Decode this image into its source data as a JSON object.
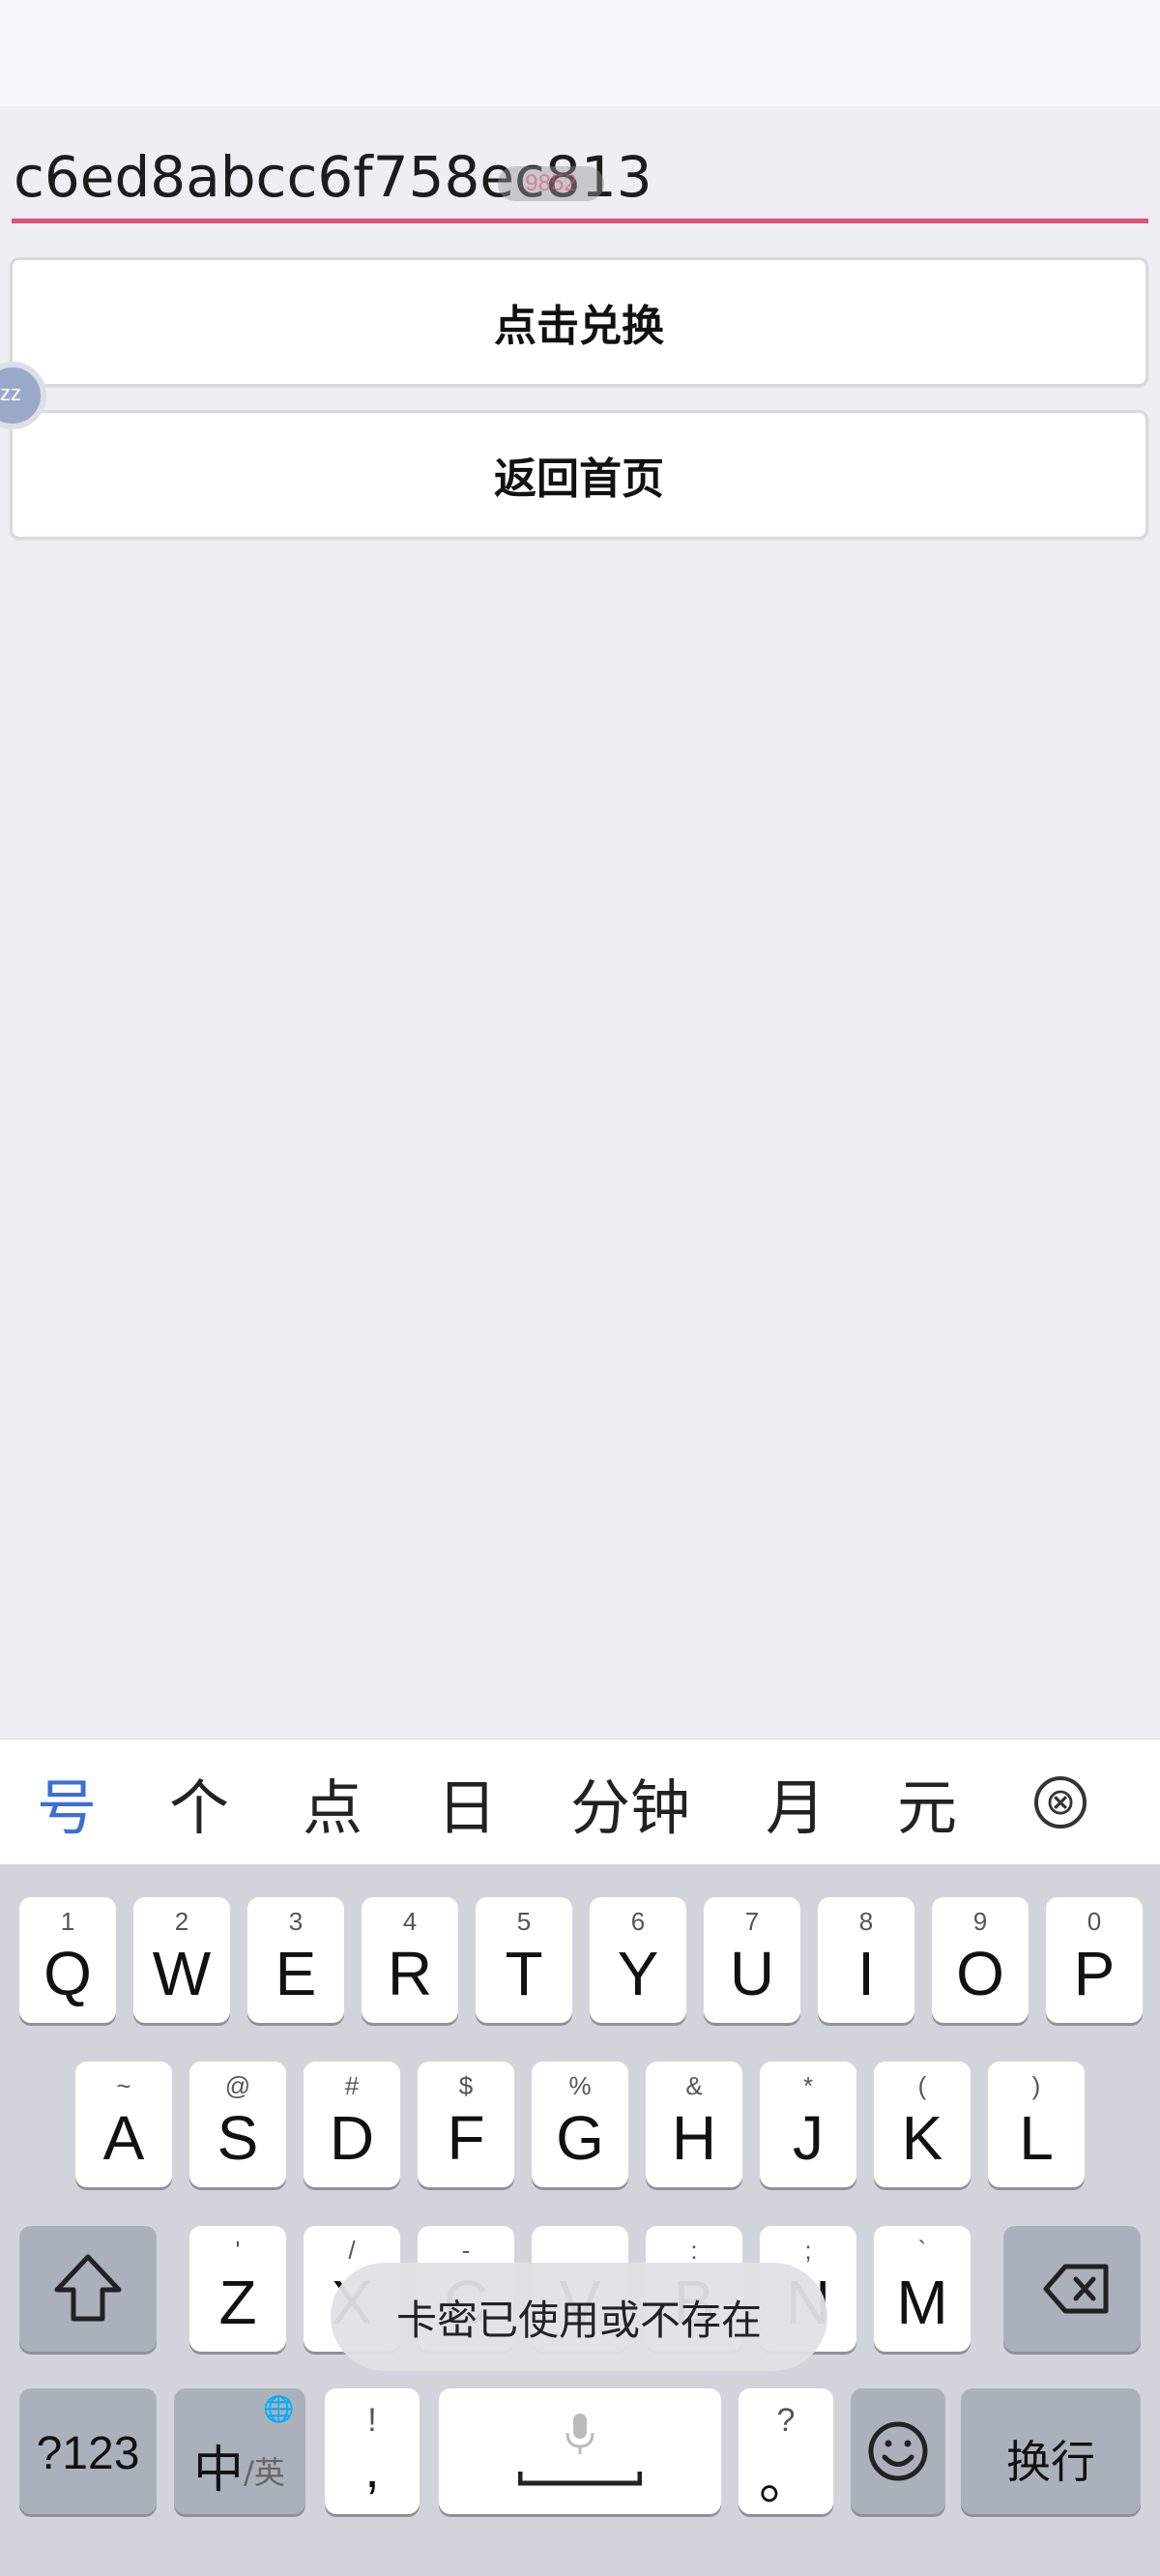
{
  "redeem_form": {
    "code_value": "c6ed8abcc6f758ec813",
    "handle_text": "9852",
    "redeem_button": "点击兑换",
    "home_button": "返回首页"
  },
  "floating_ball": {
    "label": "zz"
  },
  "ime": {
    "candidates": [
      "号",
      "个",
      "点",
      "日",
      "分钟",
      "月",
      "元"
    ],
    "close_symbol": "⊗",
    "row1": [
      {
        "n": "1",
        "k": "Q"
      },
      {
        "n": "2",
        "k": "W"
      },
      {
        "n": "3",
        "k": "E"
      },
      {
        "n": "4",
        "k": "R"
      },
      {
        "n": "5",
        "k": "T"
      },
      {
        "n": "6",
        "k": "Y"
      },
      {
        "n": "7",
        "k": "U"
      },
      {
        "n": "8",
        "k": "I"
      },
      {
        "n": "9",
        "k": "O"
      },
      {
        "n": "0",
        "k": "P"
      }
    ],
    "row2": [
      {
        "n": "~",
        "k": "A"
      },
      {
        "n": "@",
        "k": "S"
      },
      {
        "n": "#",
        "k": "D"
      },
      {
        "n": "$",
        "k": "F"
      },
      {
        "n": "%",
        "k": "G"
      },
      {
        "n": "&",
        "k": "H"
      },
      {
        "n": "*",
        "k": "J"
      },
      {
        "n": "(",
        "k": "K"
      },
      {
        "n": ")",
        "k": "L"
      }
    ],
    "row3": [
      {
        "n": "'",
        "k": "Z"
      },
      {
        "n": "/",
        "k": "X"
      },
      {
        "n": "-",
        "k": "C"
      },
      {
        "n": "",
        "k": "V"
      },
      {
        "n": ":",
        "k": "B"
      },
      {
        "n": ";",
        "k": "N"
      },
      {
        "n": "`",
        "k": "M"
      }
    ],
    "numbers_key": "?123",
    "lang_key_main": "中",
    "lang_key_sub": "/英",
    "comma_key_top": "!",
    "comma_key_main": ",",
    "period_key_top": "?",
    "period_key_main": "。",
    "enter_key": "换行"
  },
  "toast": {
    "message": "卡密已使用或不存在"
  },
  "colors": {
    "accent_underline": "#e0507a",
    "candidate_active": "#3a6fd8"
  }
}
